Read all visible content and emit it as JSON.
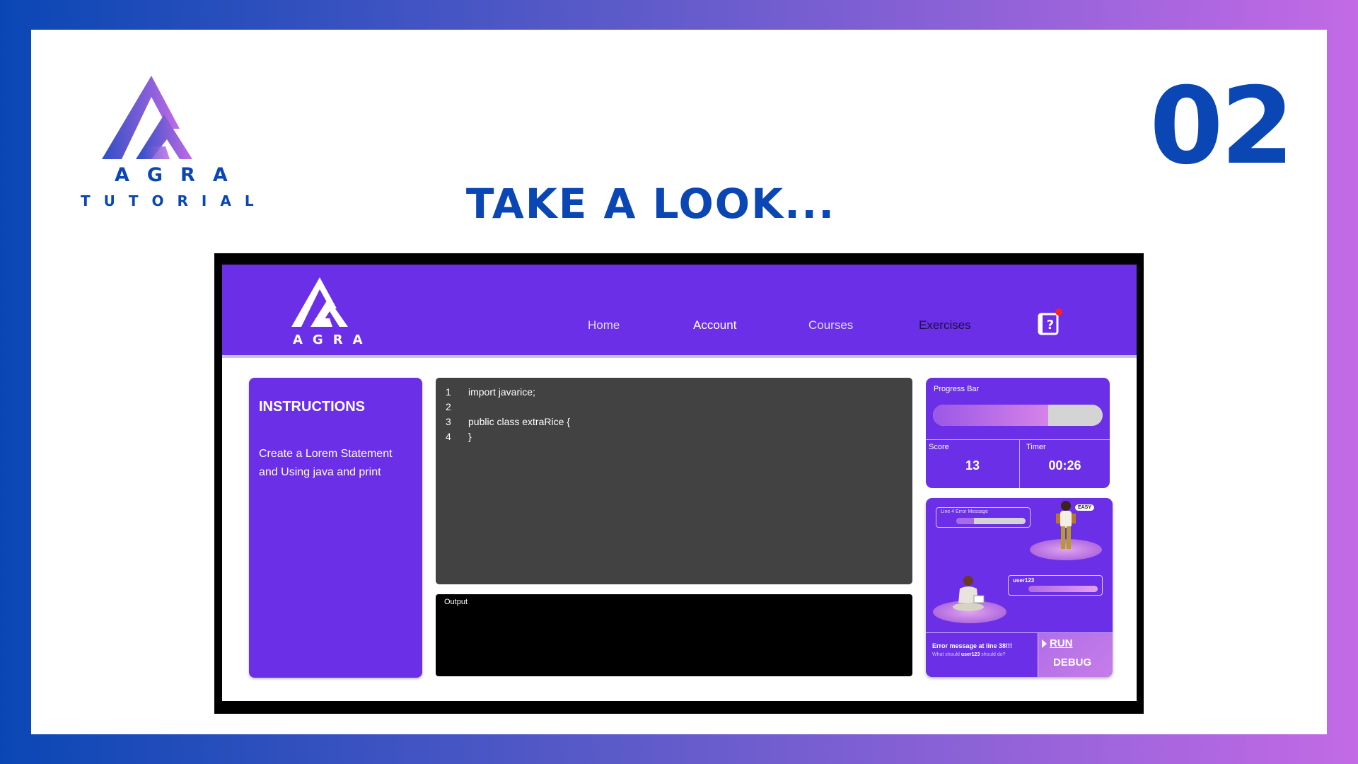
{
  "slide": {
    "brand_name": "AGRA",
    "brand_subtitle": "TUTORIAL",
    "number": "02",
    "title": "TAKE A LOOK..."
  },
  "app": {
    "logo_text": "AGRA",
    "nav": {
      "home": "Home",
      "account": "Account",
      "courses": "Courses",
      "exercises": "Exercises"
    },
    "help_icon": "help-book-icon",
    "instructions": {
      "title": "INSTRUCTIONS",
      "text": "Create a Lorem Statement and Using java and print"
    },
    "code": {
      "lines": [
        {
          "num": "1",
          "text": "import javarice;"
        },
        {
          "num": "2",
          "text": ""
        },
        {
          "num": "3",
          "text": "public class extraRice {"
        },
        {
          "num": "4",
          "text": "}"
        }
      ]
    },
    "output": {
      "label": "Output"
    },
    "stats": {
      "progress_label": "Progress Bar",
      "progress_fraction": 0.68,
      "score_label": "Score",
      "score_value": "13",
      "timer_label": "Timer",
      "timer_value": "00:26"
    },
    "game": {
      "error_box_label": "Line 4 Error Message",
      "error_bar_fraction": 0.25,
      "difficulty": "EASY",
      "user_label": "user123",
      "message": "Error message at line 38!!!",
      "sub_prefix": "What should",
      "sub_user": "user123",
      "sub_suffix": "should do?",
      "run_label": "RUN",
      "debug_label": "DEBUG"
    }
  },
  "colors": {
    "brand_blue": "#0a47b5",
    "app_purple": "#6a2fe6",
    "editor_bg": "#424242",
    "notification_red": "#ff1f1f"
  }
}
